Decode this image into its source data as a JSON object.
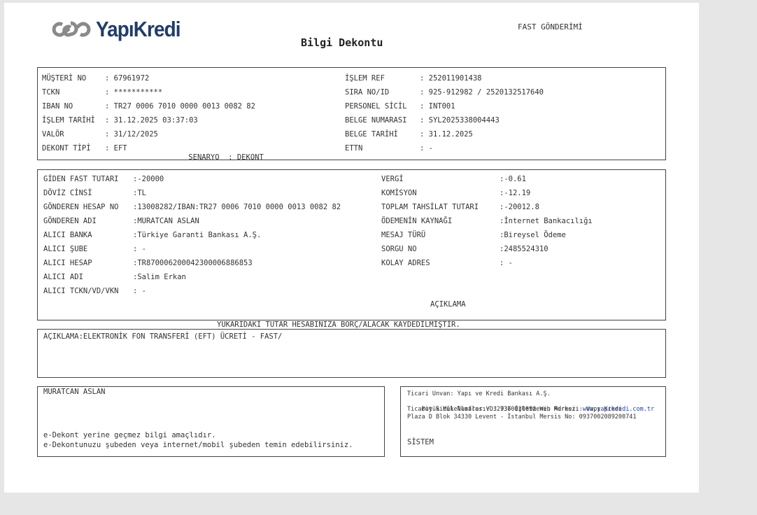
{
  "header": {
    "brand": "YapıKredi",
    "doc_type": "FAST GÖNDERİMİ",
    "title": "Bilgi Dekontu"
  },
  "info_left": [
    {
      "label": "MÜŞTERİ NO",
      "value": "67961972"
    },
    {
      "label": "TCKN",
      "value": "***********"
    },
    {
      "label": "IBAN NO",
      "value": "TR27 0006 7010 0000 0013 0082 82"
    },
    {
      "label": "İŞLEM TARİHİ",
      "value": "31.12.2025 03:37:03"
    },
    {
      "label": "VALÖR",
      "value": "31/12/2025"
    },
    {
      "label": "DEKONT TİPİ",
      "value": "EFT"
    }
  ],
  "senaryo": {
    "label": "SENARYO",
    "value": "DEKONT"
  },
  "info_right": [
    {
      "label": "İŞLEM REF",
      "value": "252011901438"
    },
    {
      "label": "SIRA NO/ID",
      "value": "925-912982 / 2520132517640"
    },
    {
      "label": "PERSONEL SİCİL",
      "value": "INT001"
    },
    {
      "label": "BELGE NUMARASI",
      "value": "SYL2025338004443"
    },
    {
      "label": "BELGE TARİHİ",
      "value": "31.12.2025"
    },
    {
      "label": "ETTN",
      "value": "-"
    }
  ],
  "tx_left": [
    {
      "label": "GİDEN FAST TUTARI",
      "value": "-20000"
    },
    {
      "label": "DÖVİZ CİNSİ",
      "value": "TL"
    },
    {
      "label": "GÖNDEREN HESAP NO",
      "value": "13008282/IBAN:TR27 0006 7010 0000 0013 0082 82"
    },
    {
      "label": "GÖNDEREN ADI",
      "value": "MURATCAN ASLAN"
    },
    {
      "label": "ALICI BANKA",
      "value": "Türkiye Garanti Bankası A.Ş."
    },
    {
      "label": "ALICI ŞUBE",
      "value": " -"
    },
    {
      "label": "ALICI HESAP",
      "value": "TR870006200042300006886853"
    },
    {
      "label": "ALICI ADI",
      "value": "Salim Erkan"
    },
    {
      "label": "ALICI TCKN/VD/VKN",
      "value": " -"
    }
  ],
  "tx_right": [
    {
      "label": "VERGİ",
      "value": "-0.61"
    },
    {
      "label": "KOMİSYON",
      "value": "-12.19"
    },
    {
      "label": "TOPLAM TAHSİLAT TUTARI",
      "value": "-20012.8"
    },
    {
      "label": "ÖDEMENİN KAYNAĞI",
      "value": "İnternet Bankacılığı"
    },
    {
      "label": "MESAJ TÜRÜ",
      "value": "Bireysel Ödeme"
    },
    {
      "label": "SORGU NO",
      "value": "2485524310"
    },
    {
      "label": "KOLAY ADRES",
      "value": " -"
    }
  ],
  "aciklama_heading": "AÇIKLAMA",
  "notice": "YUKARIDAKİ TUTAR HESABINIZA BORÇ/ALACAK KAYDEDİLMİŞTİR.",
  "description": "AÇIKLAMA:ELEKTRONİK FON TRANSFERİ (EFT) ÜCRETİ - FAST/",
  "footer_left": {
    "name": "MURATCAN ASLAN",
    "line1": "e-Dekont yerine geçmez bilgi amaçlıdır.",
    "line2": "e-Dekontunuzu şubeden veya internet/mobil şubeden temin edebilirsiniz."
  },
  "footer_right": {
    "line1": "Ticari Unvan: Yapı ve Kredi Bankası A.Ş.",
    "line2_prefix": "Büyük Mükellefler VD: 9370020892 Web Adresi: ",
    "web": "www.yapikredi.com.tr",
    "line3": "Ticaret Sicil Numarası: 32736 İşletmenin Merkezi: Yapı Kredi",
    "line4": "Plaza D Blok 34330 Levent - İstanbul Mersis No: 0937002089200741",
    "system": "SİSTEM"
  },
  "colors": {
    "brand": "#1f3c6b",
    "link": "#1a3cc8",
    "logo_gray": "#8a8a8a"
  }
}
